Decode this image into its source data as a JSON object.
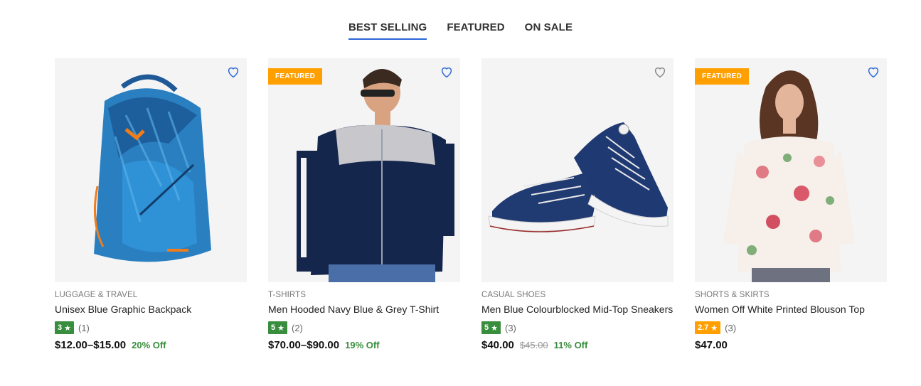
{
  "tabs": [
    {
      "label": "BEST SELLING",
      "active": true
    },
    {
      "label": "FEATURED",
      "active": false
    },
    {
      "label": "ON SALE",
      "active": false
    }
  ],
  "colors": {
    "tab_active_underline": "#2b66d9",
    "rating_green": "#388e3c",
    "rating_orange": "#ff9f00",
    "featured_badge": "#ff9f00",
    "discount_text": "#388e3c",
    "wishlist_blue": "#2b66d9",
    "wishlist_gray": "#888888"
  },
  "products": [
    {
      "category": "LUGGAGE & TRAVEL",
      "title": "Unisex Blue Graphic Backpack",
      "rating": "3",
      "rating_count": "(1)",
      "price": "$12.00–$15.00",
      "old_price": "",
      "discount": "20% Off",
      "badge": "",
      "image_icon": "backpack-image"
    },
    {
      "category": "T-SHIRTS",
      "title": "Men Hooded Navy Blue & Grey T-Shirt",
      "rating": "5",
      "rating_count": "(2)",
      "price": "$70.00–$90.00",
      "old_price": "",
      "discount": "19% Off",
      "badge": "FEATURED",
      "image_icon": "navy-jacket-image"
    },
    {
      "category": "CASUAL SHOES",
      "title": "Men Blue Colourblocked Mid-Top Sneakers",
      "rating": "5",
      "rating_count": "(3)",
      "price": "$40.00",
      "old_price": "$45.00",
      "discount": "11% Off",
      "badge": "",
      "image_icon": "sneakers-image"
    },
    {
      "category": "SHORTS & SKIRTS",
      "title": "Women Off White Printed Blouson Top",
      "rating": "2.7",
      "rating_count": "(3)",
      "price": "$47.00",
      "old_price": "",
      "discount": "",
      "badge": "FEATURED",
      "image_icon": "floral-blouse-image"
    }
  ]
}
